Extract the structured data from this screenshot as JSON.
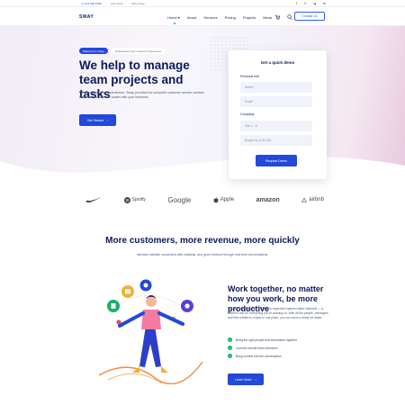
{
  "topbar": {
    "phone": "+1 212 000 5786",
    "link1": "Help Desk",
    "link2": "Why Sway",
    "social": [
      "f",
      "𝕏",
      "ig",
      "in"
    ]
  },
  "nav": {
    "logo": "SWAY",
    "items": [
      "Home ▾",
      "About",
      "Services",
      "Pricing",
      "Projects",
      "News"
    ],
    "contact": "Contact Us"
  },
  "hero": {
    "badge": "Welcome to Sway",
    "badge_text": "Guaranteed your customer experience",
    "title": "We help to manage team projects and tasks",
    "description": "The best customer experiences. Sway provides the complete customer service solution that's easy to use and scales with your business",
    "cta": "Get Started"
  },
  "form": {
    "title": "Get a quick demo",
    "personal_label": "Personal Info",
    "name_placeholder": "Name*",
    "email_placeholder": "Email*",
    "company_label": "Company",
    "size_value": "Size 1 - 5",
    "budget_value": "Budget Up to $1,000",
    "submit": "Request Demo"
  },
  "brands": [
    "Nike",
    "Spotify",
    "Google",
    "Apple",
    "amazon",
    "airbnb"
  ],
  "section": {
    "title": "More customers, more revenue, more quickly",
    "subtitle": "Increase website conversion with chatbots, and grow revenue through real-time conversations."
  },
  "feature": {
    "title": "Work together, no matter how you work, be more productive",
    "description": "The key to productivity in Sway is organized spaces called channels — a different one for everything you're working on. With all the people, messages and files related to a topic in one place, you can move a whole lot faster.",
    "checks": [
      "Bring the right people and information together",
      "Connect remote team members",
      "Bring context into the conversation"
    ],
    "cta": "Learn More"
  },
  "colors": {
    "primary": "#2448d8",
    "navy": "#0b1a5c",
    "green": "#16b26a"
  }
}
